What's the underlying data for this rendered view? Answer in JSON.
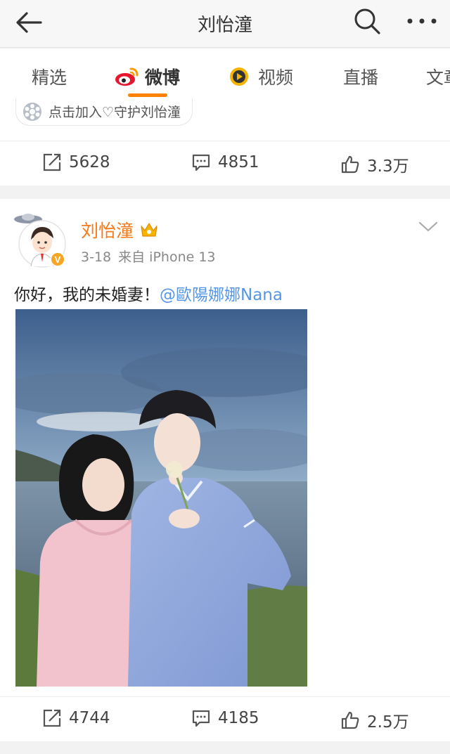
{
  "header": {
    "title": "刘怡潼"
  },
  "tabs": [
    {
      "label": "精选"
    },
    {
      "label": "微博"
    },
    {
      "label": "视频"
    },
    {
      "label": "直播"
    },
    {
      "label": "文章"
    }
  ],
  "fan_banner": {
    "text": "点击加入♡守护刘怡潼"
  },
  "post1": {
    "reposts": "5628",
    "comments": "4851",
    "likes": "3.3万"
  },
  "post2": {
    "author": "刘怡潼",
    "date": "3-18",
    "source": "来自 iPhone 13",
    "text": "你好，我的未婚妻！",
    "mention": "@歐陽娜娜Nana",
    "reposts": "4744",
    "comments": "4185",
    "likes": "2.5万"
  },
  "colors": {
    "accent": "#ff8200",
    "username": "#f37b1d",
    "mention": "#5596e6"
  }
}
